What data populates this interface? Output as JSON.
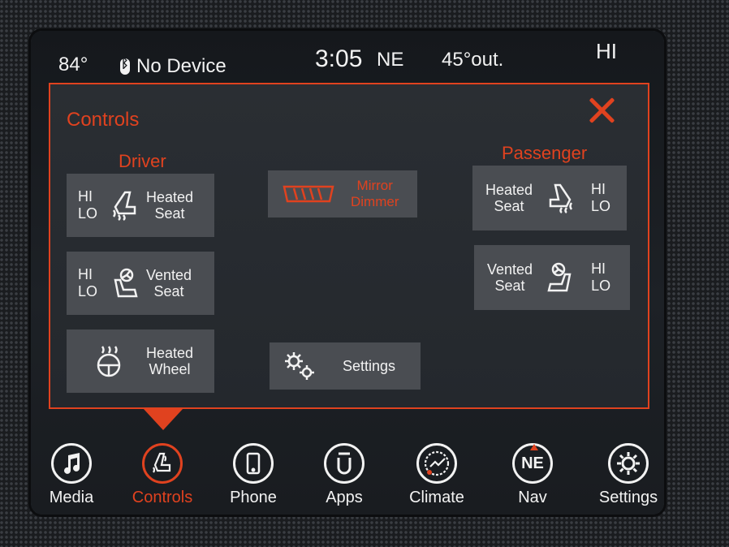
{
  "status": {
    "temperature": "84°",
    "device": "No Device",
    "clock": "3:05",
    "heading": "NE",
    "outside_temp": "45°out.",
    "fan_level": "HI"
  },
  "panel": {
    "title": "Controls",
    "driver_label": "Driver",
    "passenger_label": "Passenger",
    "driver_heated_seat": {
      "hi": "HI",
      "lo": "LO",
      "label_line1": "Heated",
      "label_line2": "Seat"
    },
    "driver_vented_seat": {
      "hi": "HI",
      "lo": "LO",
      "label_line1": "Vented",
      "label_line2": "Seat"
    },
    "heated_wheel": {
      "label_line1": "Heated",
      "label_line2": "Wheel"
    },
    "mirror_dimmer": {
      "label_line1": "Mirror",
      "label_line2": "Dimmer"
    },
    "settings": {
      "label": "Settings"
    },
    "passenger_heated_seat": {
      "hi": "HI",
      "lo": "LO",
      "label_line1": "Heated",
      "label_line2": "Seat"
    },
    "passenger_vented_seat": {
      "hi": "HI",
      "lo": "LO",
      "label_line1": "Vented",
      "label_line2": "Seat"
    }
  },
  "nav": {
    "media": "Media",
    "controls": "Controls",
    "phone": "Phone",
    "apps": "Apps",
    "climate": "Climate",
    "nav": "Nav",
    "nav_compass": "NE",
    "settings": "Settings"
  },
  "colors": {
    "accent": "#e0421f",
    "tile": "#4a4d52",
    "text": "#f2f2f2"
  }
}
